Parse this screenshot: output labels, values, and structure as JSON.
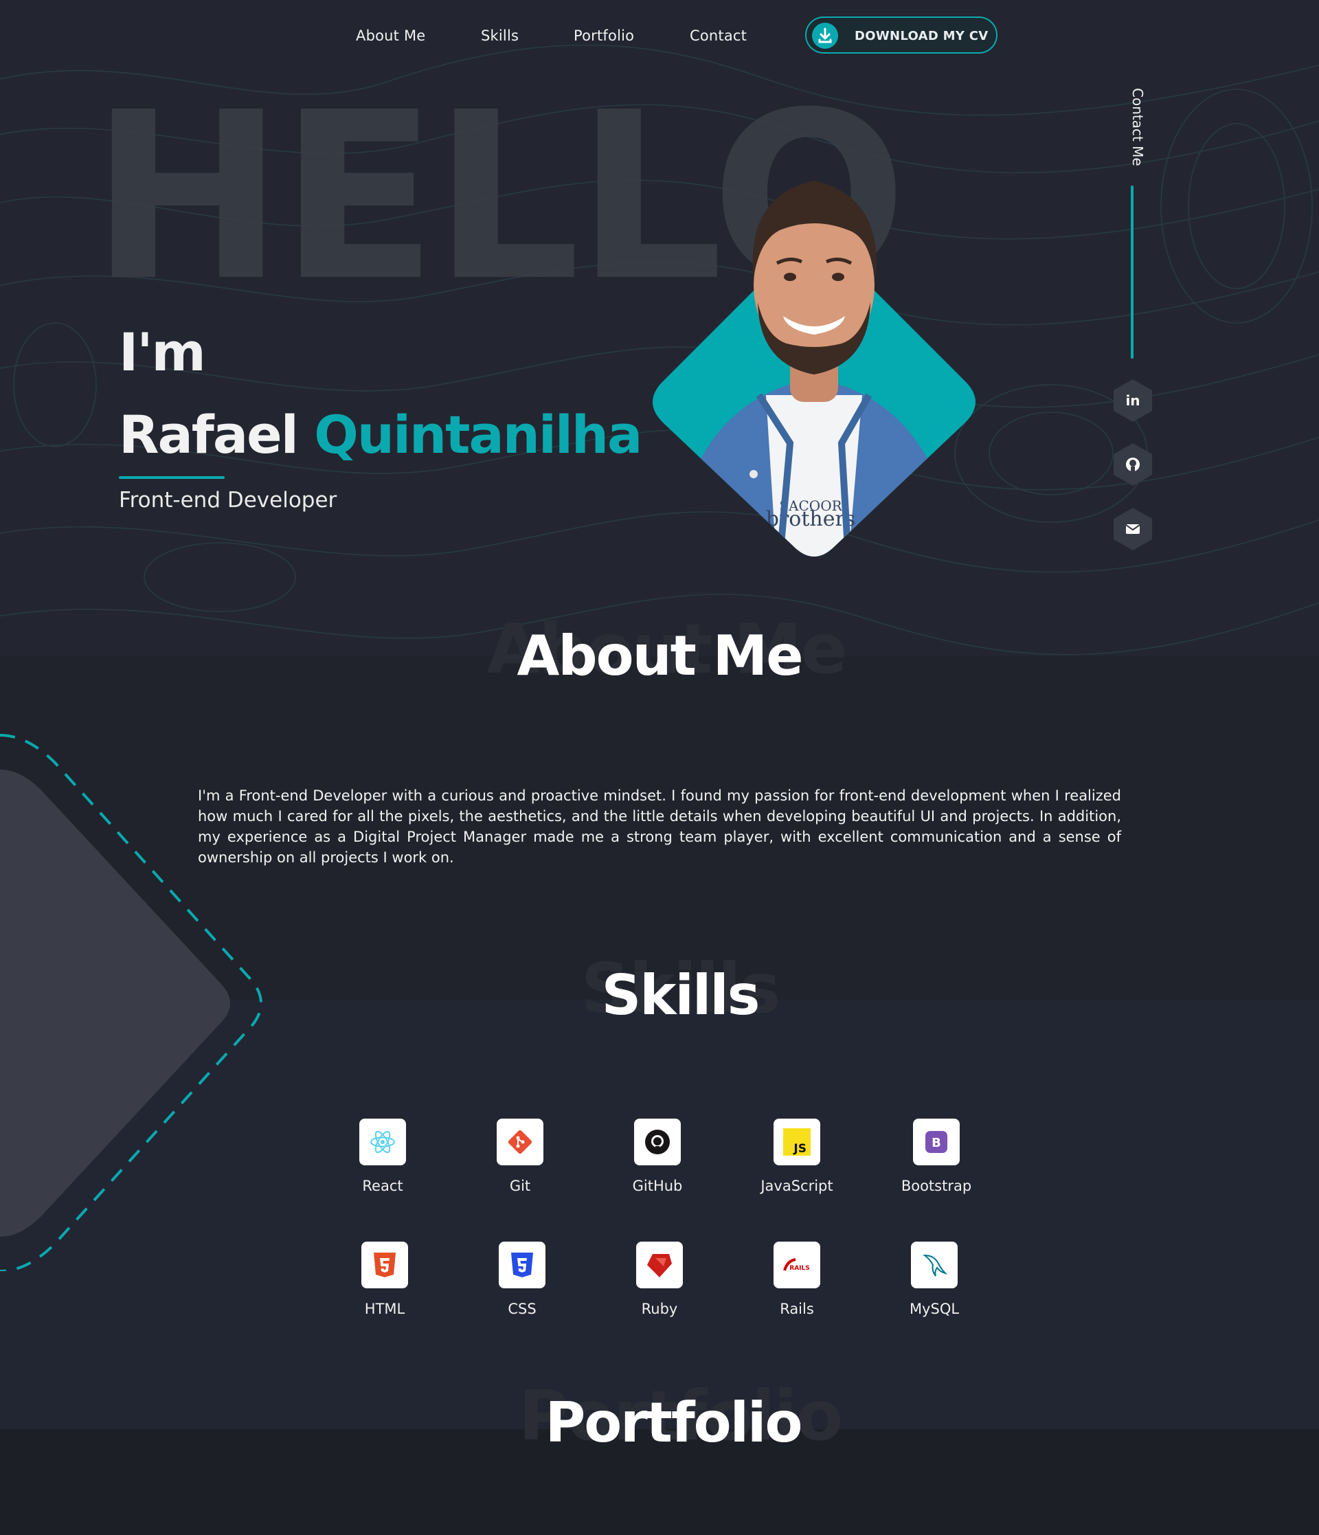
{
  "nav": {
    "links": [
      "About Me",
      "Skills",
      "Portfolio",
      "Contact"
    ],
    "cv_button": "DOWNLOAD MY CV"
  },
  "hero": {
    "background_word": "HELLO",
    "intro": "I'm",
    "first_name": "Rafael",
    "last_name": "Quintanilha",
    "role": "Front-end Developer",
    "shirt_text_top": "SACOOR",
    "shirt_text_bottom": "brothers"
  },
  "contact_rail": {
    "label": "Contact Me",
    "links": [
      {
        "icon": "linkedin-icon",
        "glyph": "in"
      },
      {
        "icon": "github-icon",
        "glyph": ""
      },
      {
        "icon": "email-icon",
        "glyph": ""
      }
    ]
  },
  "about": {
    "title": "About Me",
    "ghost": "About Me",
    "text": "I'm a Front-end Developer with a curious and proactive mindset. I found my passion for front-end development when I realized how much I cared for all the pixels, the aesthetics, and the little details when developing beautiful UI and projects. In addition, my experience as a Digital Project Manager made me a strong team player, with excellent communication and a sense of ownership on all projects I work on."
  },
  "skills": {
    "title": "Skills",
    "ghost": "Skills",
    "items": [
      {
        "label": "React",
        "icon": "react-icon"
      },
      {
        "label": "Git",
        "icon": "git-icon"
      },
      {
        "label": "GitHub",
        "icon": "github-icon"
      },
      {
        "label": "JavaScript",
        "icon": "javascript-icon"
      },
      {
        "label": "Bootstrap",
        "icon": "bootstrap-icon"
      },
      {
        "label": "HTML",
        "icon": "html-icon"
      },
      {
        "label": "CSS",
        "icon": "css-icon"
      },
      {
        "label": "Ruby",
        "icon": "ruby-icon"
      },
      {
        "label": "Rails",
        "icon": "rails-icon"
      },
      {
        "label": "MySQL",
        "icon": "mysql-icon"
      }
    ]
  },
  "portfolio": {
    "title": "Portfolio",
    "ghost": "Portfolio"
  },
  "colors": {
    "accent": "#0aa9b0",
    "background": "#20232b",
    "hero_background": "#232630"
  }
}
